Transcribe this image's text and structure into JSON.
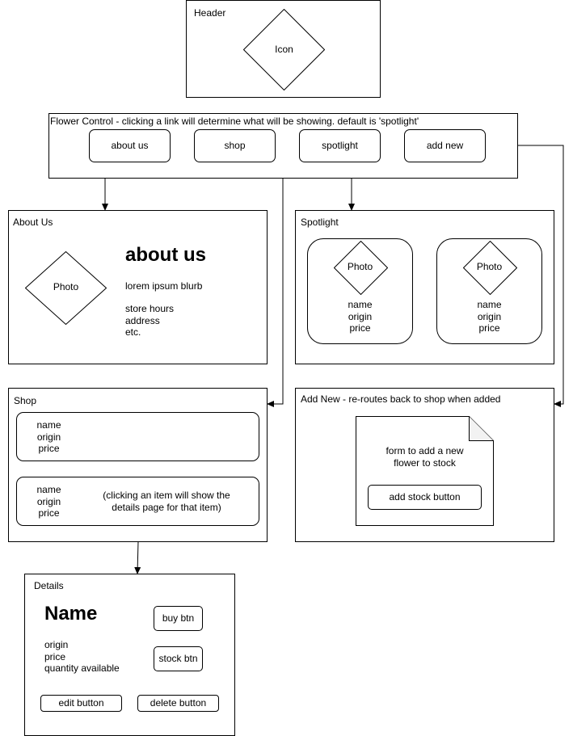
{
  "header": {
    "title": "Header",
    "icon_label": "Icon"
  },
  "flower_control": {
    "title": "Flower Control - clicking a link will determine what will be showing. default is 'spotlight'",
    "links": [
      "about us",
      "shop",
      "spotlight",
      "add new"
    ]
  },
  "about_us": {
    "title": "About Us",
    "photo_label": "Photo",
    "heading": "about us",
    "blurb": "lorem ipsum blurb",
    "info_lines": [
      "store hours",
      "address",
      "etc."
    ]
  },
  "spotlight": {
    "title": "Spotlight",
    "cards": [
      {
        "photo_label": "Photo",
        "lines": [
          "name",
          "origin",
          "price"
        ]
      },
      {
        "photo_label": "Photo",
        "lines": [
          "name",
          "origin",
          "price"
        ]
      }
    ]
  },
  "shop": {
    "title": "Shop",
    "items": [
      {
        "lines": [
          "name",
          "origin",
          "price"
        ]
      },
      {
        "lines": [
          "name",
          "origin",
          "price"
        ]
      }
    ],
    "note_lines": [
      "(clicking an item will show the",
      "details page for that item)"
    ]
  },
  "add_new": {
    "title": "Add New - re-routes back to shop when added",
    "form_lines": [
      "form to add a new",
      "flower to stock"
    ],
    "button": "add stock button"
  },
  "details": {
    "title": "Details",
    "name": "Name",
    "info_lines": [
      "origin",
      "price",
      "quantity available"
    ],
    "buy_button": "buy btn",
    "stock_button": "stock btn",
    "edit_button": "edit button",
    "delete_button": "delete button"
  }
}
